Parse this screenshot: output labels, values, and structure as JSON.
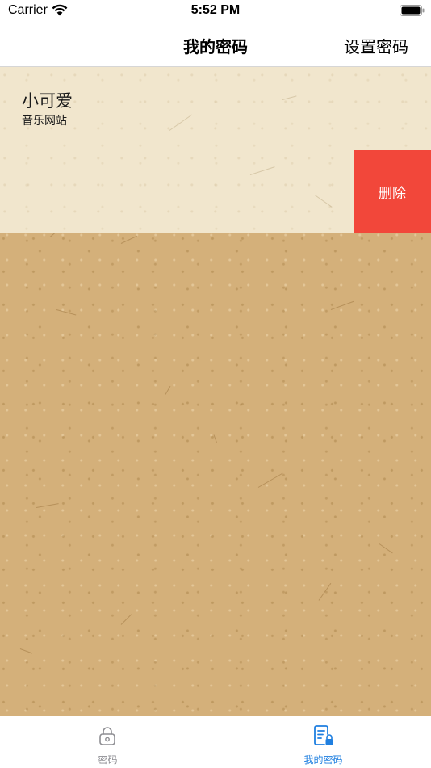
{
  "status_bar": {
    "carrier": "Carrier",
    "time": "5:52 PM",
    "icons": [
      "wifi-icon",
      "battery-icon"
    ]
  },
  "nav": {
    "title": "我的密码",
    "right_button": "设置密码"
  },
  "list": {
    "items": [
      {
        "title": "小可爱",
        "subtitle": "音乐网站"
      },
      {
        "title": "",
        "subtitle": ""
      }
    ],
    "delete_label": "删除"
  },
  "tab_bar": {
    "tabs": [
      {
        "label": "密码",
        "icon": "lock-icon",
        "selected": false
      },
      {
        "label": "我的密码",
        "icon": "document-lock-icon",
        "selected": true
      }
    ]
  },
  "colors": {
    "delete": "#f2473a",
    "tab_active": "#1f7fe0",
    "tab_inactive": "#8e8e93",
    "paper": "#d4b07a",
    "row": "#f1e6cd"
  }
}
